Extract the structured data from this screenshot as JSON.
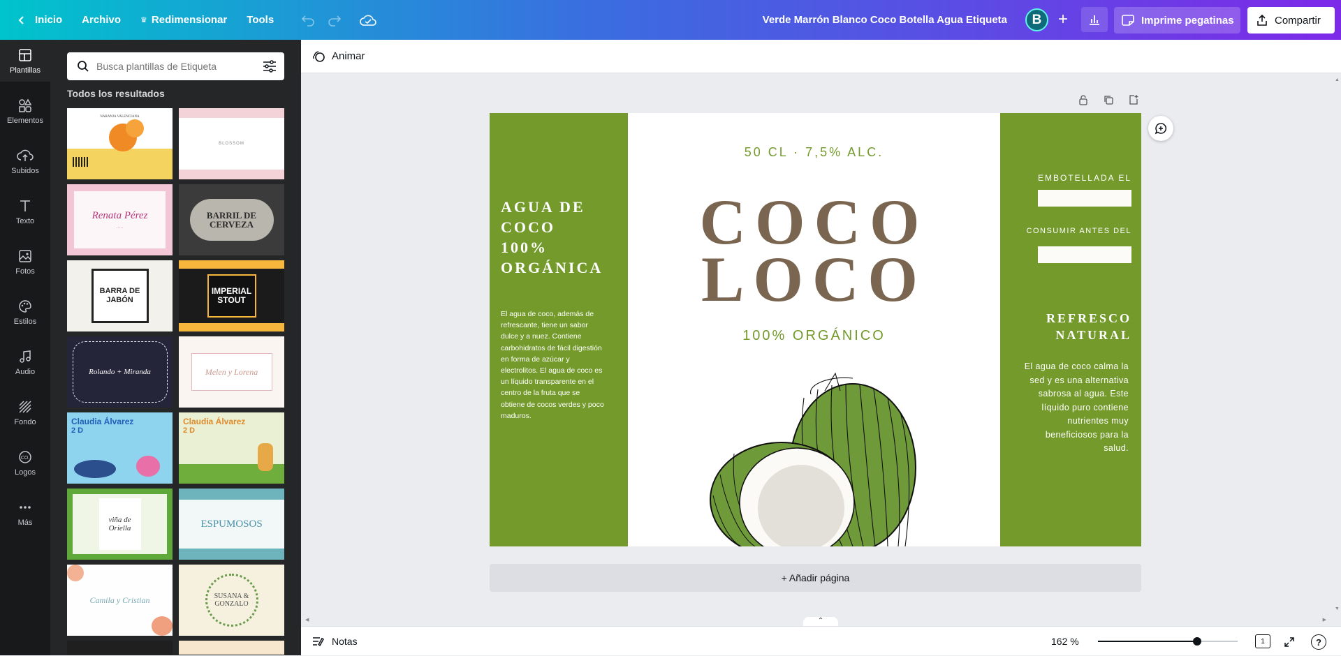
{
  "topbar": {
    "home_label": "Inicio",
    "file_label": "Archivo",
    "resize_label": "Redimensionar",
    "tools_label": "Tools",
    "doc_title": "Verde Marrón Blanco Coco Botella Agua Etiqueta",
    "avatar_letter": "B",
    "print_label": "Imprime pegatinas",
    "share_label": "Compartir"
  },
  "rail": {
    "items": [
      {
        "label": "Plantillas",
        "icon": "templates-icon"
      },
      {
        "label": "Elementos",
        "icon": "elements-icon"
      },
      {
        "label": "Subidos",
        "icon": "upload-icon"
      },
      {
        "label": "Texto",
        "icon": "text-icon"
      },
      {
        "label": "Fotos",
        "icon": "photos-icon"
      },
      {
        "label": "Estilos",
        "icon": "palette-icon"
      },
      {
        "label": "Audio",
        "icon": "music-icon"
      },
      {
        "label": "Fondo",
        "icon": "background-icon"
      },
      {
        "label": "Logos",
        "icon": "logo-icon"
      },
      {
        "label": "Más",
        "icon": "more-icon"
      }
    ]
  },
  "panel": {
    "search_placeholder": "Busca plantillas de Etiqueta",
    "results_title": "Todos los resultados",
    "templates": [
      {
        "title": "NARANJA VALENCIANA",
        "bg": "#f4d35e"
      },
      {
        "title": "BLOSSOM",
        "bg": "#f3d2d8"
      },
      {
        "title": "Renata Pérez",
        "bg": "#fdf6f8"
      },
      {
        "title": "BARRIL DE CERVEZA",
        "bg": "#3b3b3b"
      },
      {
        "title": "BARRA DE JABÓN",
        "bg": "#f3f1ec"
      },
      {
        "title": "IMPERIAL STOUT",
        "bg": "#1b1b1b"
      },
      {
        "title": "Rolando + Miranda",
        "bg": "#25253a"
      },
      {
        "title": "Melen y Lorena",
        "bg": "#fbf5f1"
      },
      {
        "title": "Claudia Álvarez",
        "bg": "#8fd4ef"
      },
      {
        "title": "Claudia Álvarez",
        "bg": "#e9f0d3"
      },
      {
        "title": "viña de Oriella",
        "bg": "#eff6e5"
      },
      {
        "title": "ESPUMOSOS",
        "bg": "#f2f7f8"
      },
      {
        "title": "Camila y Cristian",
        "bg": "#fefefe"
      },
      {
        "title": "SUSANA & GONZALO",
        "bg": "#f5f1de"
      }
    ]
  },
  "editor": {
    "animate_label": "Animar",
    "add_page_label": "+ Añadir página"
  },
  "label_design": {
    "left_heading": "AGUA DE COCO 100% ORGÁNICA",
    "left_body": "El agua de coco, además de refrescante, tiene un sabor dulce y a nuez. Contiene carbohidratos de fácil digestión en forma de azúcar y electrolitos. El agua de coco es un líquido transparente en el centro de la fruta que se obtiene de cocos verdes y poco maduros.",
    "volume": "50 CL · 7,5% ALC.",
    "brand_line1": "COCO",
    "brand_line2": "LOCO",
    "organic": "100% ORGÁNICO",
    "bottled_label": "EMBOTELLADA EL",
    "best_before_label": "CONSUMIR ANTES DEL",
    "right_heading": "REFRESCO NATURAL",
    "right_body": "El agua de coco calma la sed y es una alternativa sabrosa al agua. Este líquido puro contiene nutrientes muy beneficiosos para la salud.",
    "green": "#739a2b",
    "brown": "#7a6650"
  },
  "bottombar": {
    "notes_label": "Notas",
    "zoom": "162 %",
    "zoom_level": 0.71,
    "page_number": "1"
  }
}
